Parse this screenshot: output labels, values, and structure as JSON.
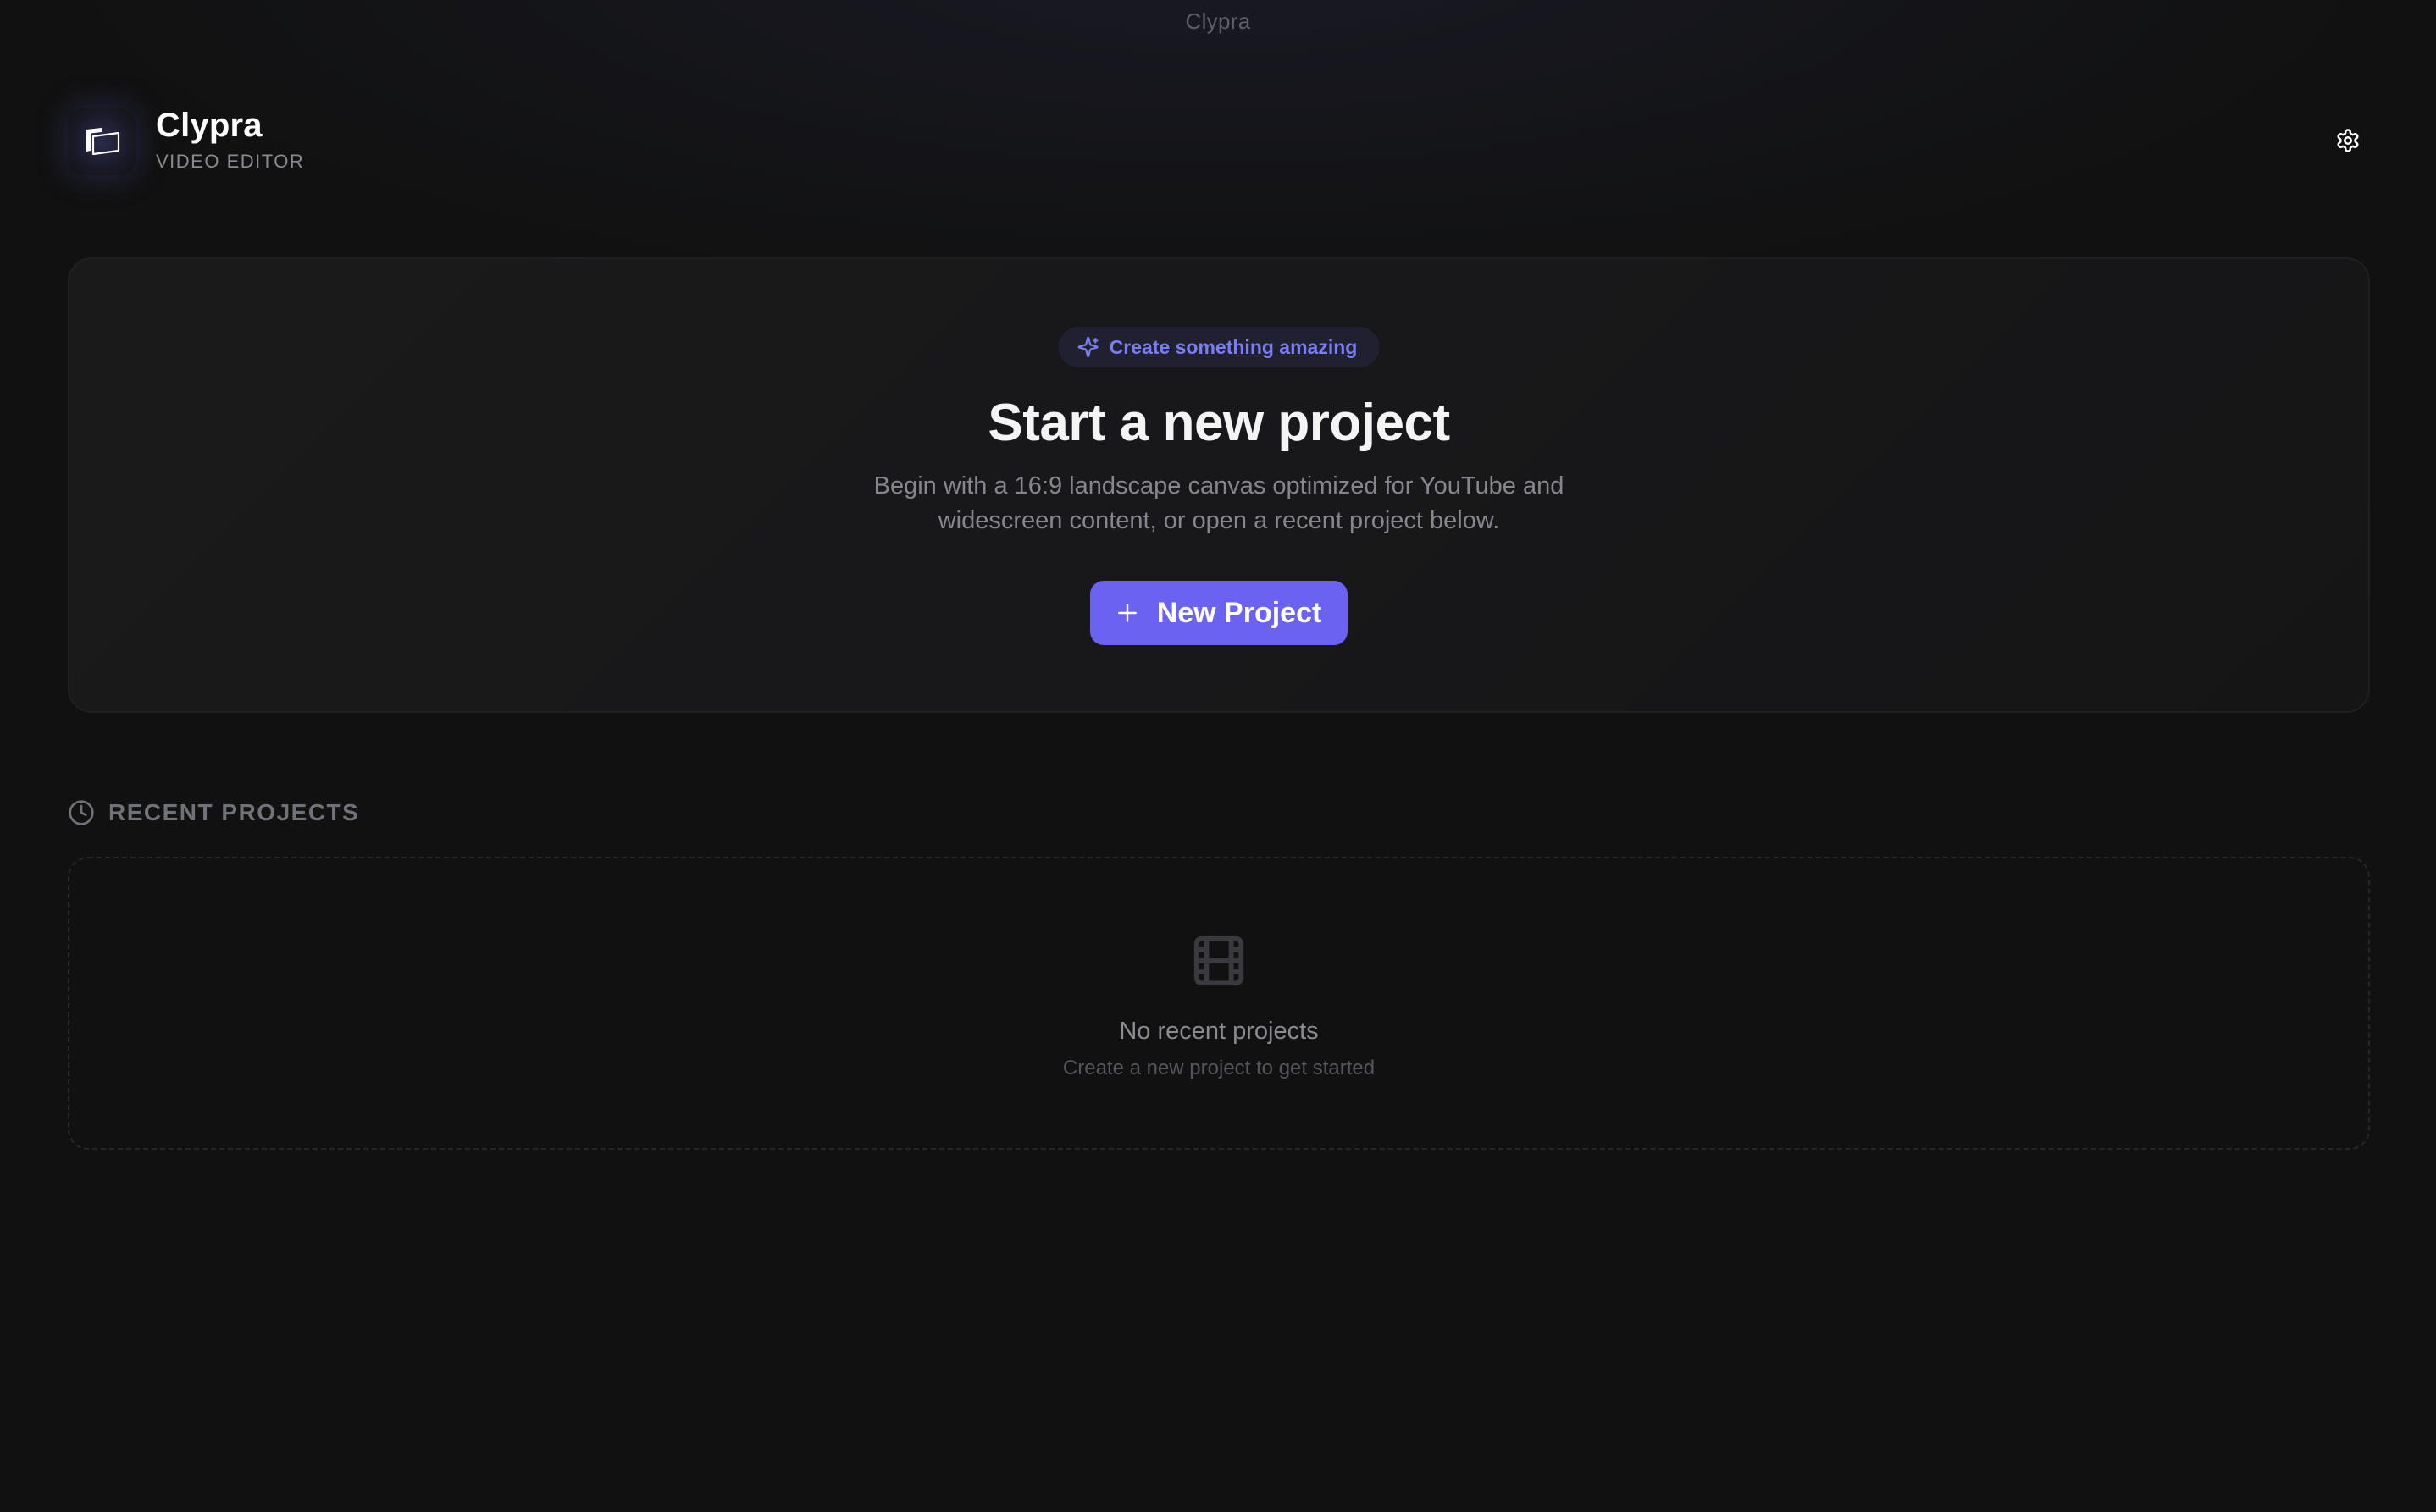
{
  "window": {
    "title": "Clypra"
  },
  "header": {
    "brand_name": "Clypra",
    "brand_subtitle": "VIDEO EDITOR",
    "logo_icon": "clapperboard-icon",
    "settings_icon": "gear-icon"
  },
  "hero": {
    "badge_icon": "sparkles-icon",
    "badge_text": "Create something amazing",
    "title": "Start a new project",
    "description": "Begin with a 16:9 landscape canvas optimized for YouTube and widescreen content, or open a recent project below.",
    "button_icon": "plus-icon",
    "button_label": "New Project"
  },
  "recent": {
    "heading_icon": "clock-icon",
    "heading": "RECENT PROJECTS",
    "empty_icon": "film-icon",
    "empty_title": "No recent projects",
    "empty_subtitle": "Create a new project to get started"
  },
  "colors": {
    "background": "#111111",
    "accent": "#6b62f2",
    "badge_text": "#7b7ef2",
    "muted_text": "#86878d"
  }
}
